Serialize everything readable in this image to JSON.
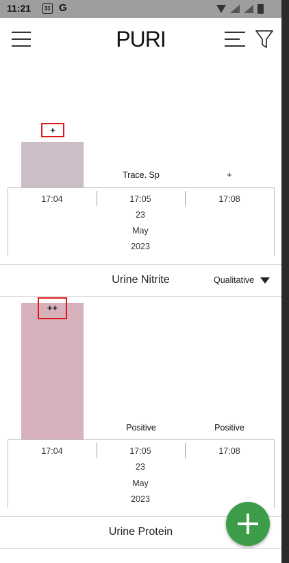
{
  "status_bar": {
    "time": "11:21",
    "calendar_day": "31",
    "g_label": "G"
  },
  "app_bar": {
    "title": "PURI"
  },
  "chart_1": {
    "top_label": "+",
    "col_labels": [
      "Trace. Sp",
      "+"
    ],
    "times": [
      "17:04",
      "17:05",
      "17:08"
    ],
    "date": [
      "23",
      "May",
      "2023"
    ]
  },
  "section_nitrite": {
    "name": "Urine Nitrite",
    "mode": "Qualitative"
  },
  "chart_2": {
    "top_label": "++",
    "col_labels": [
      "Positive",
      "Positive"
    ],
    "times": [
      "17:04",
      "17:05",
      "17:08"
    ],
    "date": [
      "23",
      "May",
      "2023"
    ]
  },
  "section_protein": {
    "name": "Urine Protein"
  },
  "colors": {
    "bar1": "#cbbec6",
    "bar2": "#d7b1bc",
    "fab": "#3d9c47",
    "highlight": "#e0161a"
  },
  "chart_data": [
    {
      "type": "bar",
      "categories": [
        "17:04",
        "17:05",
        "17:08"
      ],
      "values_text": [
        "+",
        "Trace. Sp",
        "+"
      ]
    },
    {
      "type": "bar",
      "categories": [
        "17:04",
        "17:05",
        "17:08"
      ],
      "values_text": [
        "++",
        "Positive",
        "Positive"
      ]
    }
  ]
}
